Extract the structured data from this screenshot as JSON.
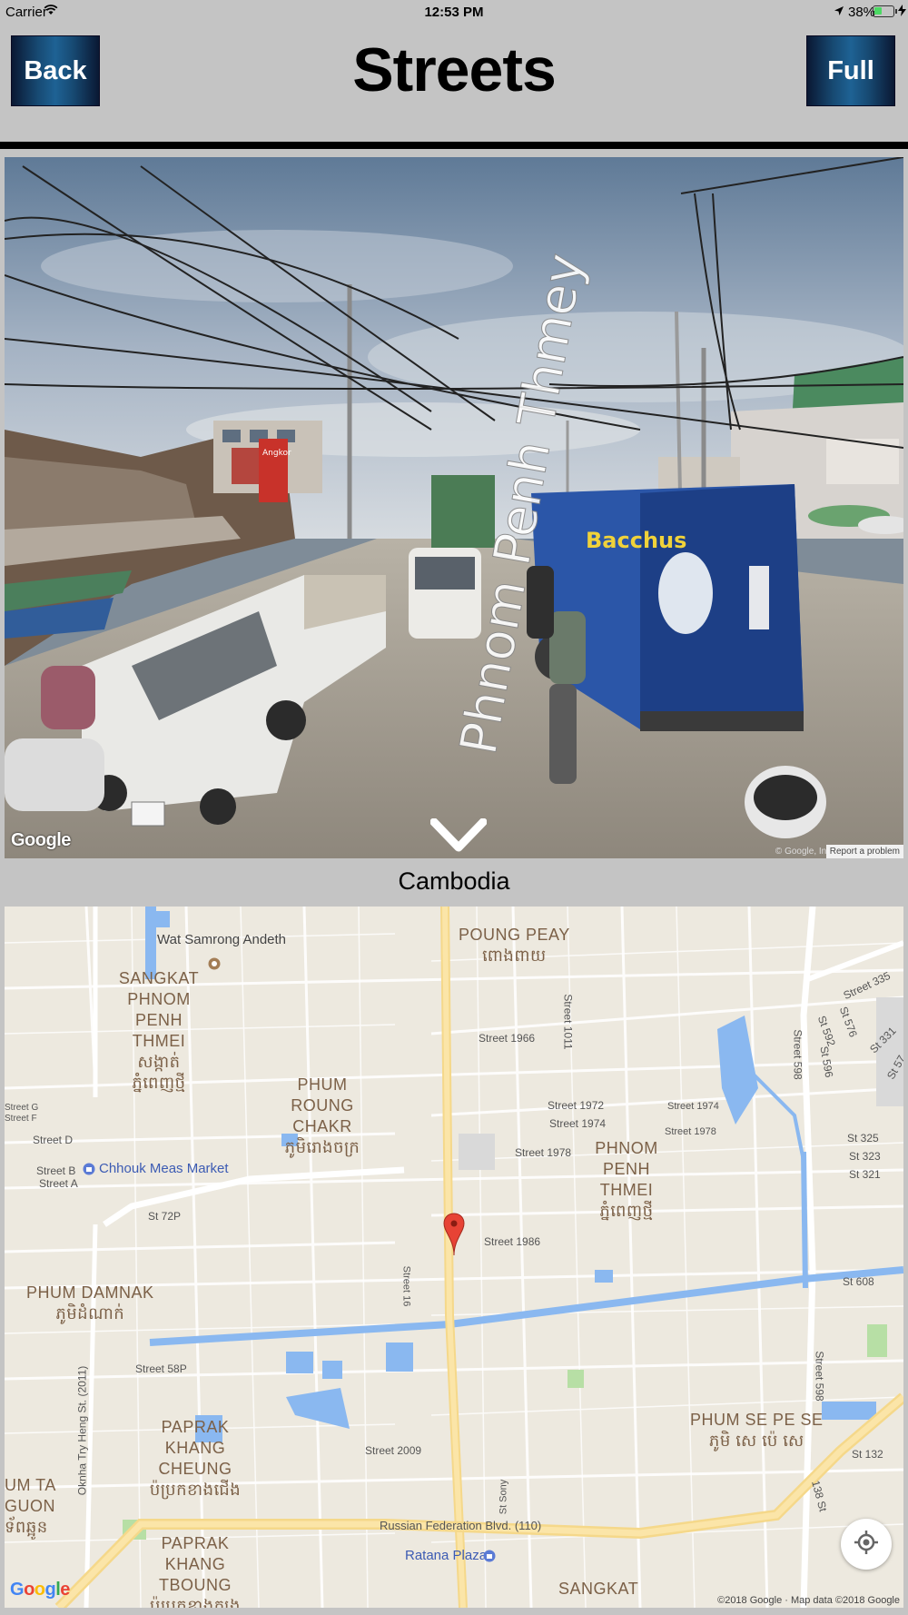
{
  "status_bar": {
    "carrier": "Carrier",
    "time": "12:53 PM",
    "battery": "38%"
  },
  "nav": {
    "back_label": "Back",
    "title": "Streets",
    "full_label": "Full"
  },
  "street_view": {
    "road_label": "Phnom Penh Thmey",
    "logo": "Google",
    "copyright": "© Google, Inc.",
    "report": "Report a problem",
    "signs": [
      "Angkor",
      "Bacchus"
    ]
  },
  "caption": "Cambodia",
  "map": {
    "logo": "Google",
    "copyright": "©2018 Google · Map data ©2018 Google",
    "areas": [
      {
        "name": "POUNG PEAY",
        "khmer": "ពោងពាយ"
      },
      {
        "name": "SANGKAT PHNOM PENH THMEI",
        "khmer": "សង្កាត់ ភ្នំពេញថ្មី"
      },
      {
        "name": "PHUM ROUNG CHAKR",
        "khmer": "ភូមិរោងចក្រ"
      },
      {
        "name": "PHNOM PENH THMEI",
        "khmer": "ភ្នំពេញថ្មី"
      },
      {
        "name": "PHUM DAMNAK",
        "khmer": "ភូមិដំណាក់"
      },
      {
        "name": "PAPRAK KHANG CHEUNG",
        "khmer": "ប៉ប្រកខាងជើង"
      },
      {
        "name": "PHUM SE PE SE",
        "khmer": "ភូមិ សេ ប៉េ សេ"
      },
      {
        "name": "UM TA GUON",
        "khmer": "ទ័ពឆ្អូន"
      },
      {
        "name": "PAPRAK KHANG TBOUNG",
        "khmer": "ប៉ប្រកខាងត្បូង"
      },
      {
        "name": "SANGKAT",
        "khmer": ""
      }
    ],
    "pois": [
      "Wat Samrong Andeth",
      "Chhouk Meas Market",
      "Ratana Plaza"
    ],
    "streets": [
      "Street 1966",
      "Street 1011",
      "Street 1972",
      "Street 1974",
      "Street 1978",
      "Street 1986",
      "Street 1974",
      "Street 1978",
      "Street D",
      "Street B",
      "Street A",
      "Street G",
      "Street F",
      "St 72P",
      "Street 16",
      "Street 58P",
      "Street 2009",
      "St Sony",
      "Oknha Try Heng St. (2011)",
      "Russian Federation Blvd. (110)",
      "Street 598",
      "St 592",
      "St 576",
      "St 596",
      "Street 335",
      "St 331",
      "St 57",
      "St 325",
      "St 323",
      "St 321",
      "St 608",
      "St 132",
      "138 St",
      "Street 598"
    ]
  }
}
